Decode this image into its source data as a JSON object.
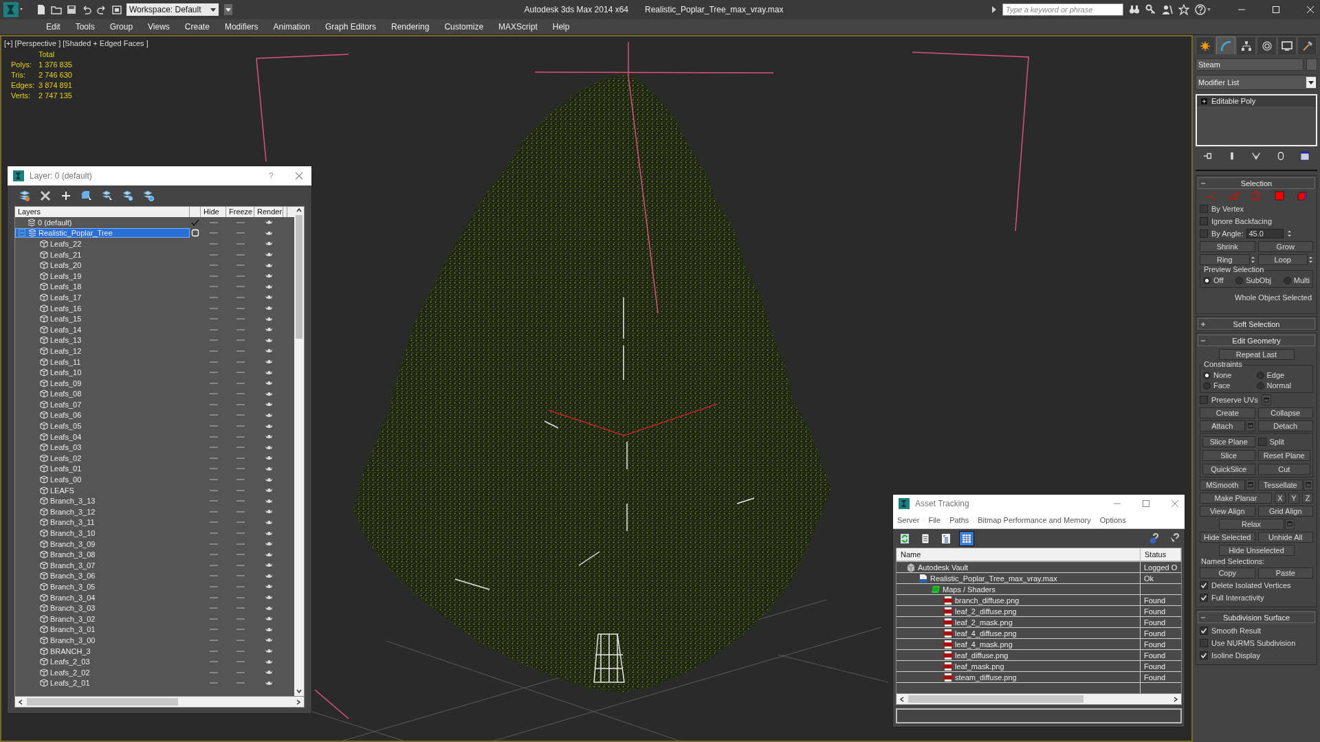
{
  "title_bar": {
    "workspace": "Workspace: Default",
    "app_title": "Autodesk 3ds Max 2014 x64",
    "file_name": "Realistic_Poplar_Tree_max_vray.max",
    "search": {
      "placeholder": "Type a keyword or phrase"
    }
  },
  "menu": [
    "Edit",
    "Tools",
    "Group",
    "Views",
    "Create",
    "Modifiers",
    "Animation",
    "Graph Editors",
    "Rendering",
    "Customize",
    "MAXScript",
    "Help"
  ],
  "viewport": {
    "label": "[+] [Perspective ] [Shaded + Edged Faces ]",
    "stats": {
      "header": "Total",
      "rows": [
        {
          "label": "Polys:",
          "value": "1 376 835"
        },
        {
          "label": "Tris:",
          "value": "2 746 630"
        },
        {
          "label": "Edges:",
          "value": "3 874 891"
        },
        {
          "label": "Verts:",
          "value": "2 747 135"
        }
      ]
    }
  },
  "layer_manager": {
    "title": "Layer: 0 (default)",
    "help": "?",
    "columns": [
      "Layers",
      "Hide",
      "Freeze",
      "Render"
    ],
    "layers": [
      {
        "name": "0 (default)",
        "current": true,
        "selected": false
      },
      {
        "name": "Realistic_Poplar_Tree",
        "current": false,
        "selected": true,
        "expanded": true,
        "children": [
          {
            "name": "Leafs_22",
            "selected": false
          },
          {
            "name": "Leafs_21",
            "selected": false
          },
          {
            "name": "Leafs_20",
            "selected": false
          },
          {
            "name": "Leafs_19",
            "selected": false
          },
          {
            "name": "Leafs_18",
            "selected": false
          },
          {
            "name": "Leafs_17",
            "selected": false
          },
          {
            "name": "Leafs_16",
            "selected": false
          },
          {
            "name": "Leafs_15",
            "selected": false
          },
          {
            "name": "Leafs_14",
            "selected": false
          },
          {
            "name": "Leafs_13",
            "selected": false
          },
          {
            "name": "Leafs_12",
            "selected": false
          },
          {
            "name": "Leafs_11",
            "selected": false
          },
          {
            "name": "Leafs_10",
            "selected": false
          },
          {
            "name": "Leafs_09",
            "selected": false
          },
          {
            "name": "Leafs_08",
            "selected": false
          },
          {
            "name": "Leafs_07",
            "selected": false
          },
          {
            "name": "Leafs_06",
            "selected": false
          },
          {
            "name": "Leafs_05",
            "selected": false
          },
          {
            "name": "Leafs_04",
            "selected": false
          },
          {
            "name": "Leafs_03",
            "selected": false
          },
          {
            "name": "Leafs_02",
            "selected": false
          },
          {
            "name": "Leafs_01",
            "selected": false
          },
          {
            "name": "Leafs_00",
            "selected": false
          },
          {
            "name": "LEAFS",
            "selected": false
          },
          {
            "name": "Branch_3_13",
            "selected": false
          },
          {
            "name": "Branch_3_12",
            "selected": false
          },
          {
            "name": "Branch_3_11",
            "selected": false
          },
          {
            "name": "Branch_3_10",
            "selected": false
          },
          {
            "name": "Branch_3_09",
            "selected": false
          },
          {
            "name": "Branch_3_08",
            "selected": false
          },
          {
            "name": "Branch_3_07",
            "selected": false
          },
          {
            "name": "Branch_3_06",
            "selected": false
          },
          {
            "name": "Branch_3_05",
            "selected": false
          },
          {
            "name": "Branch_3_04",
            "selected": false
          },
          {
            "name": "Branch_3_03",
            "selected": false
          },
          {
            "name": "Branch_3_02",
            "selected": false
          },
          {
            "name": "Branch_3_01",
            "selected": false
          },
          {
            "name": "Branch_3_00",
            "selected": false
          },
          {
            "name": "BRANCH_3",
            "selected": false
          },
          {
            "name": "Leafs_2_03",
            "selected": false
          },
          {
            "name": "Leafs_2_02",
            "selected": false
          },
          {
            "name": "Leafs_2_01",
            "selected": false
          }
        ]
      }
    ]
  },
  "asset_tracking": {
    "title": "Asset Tracking",
    "menu": [
      "Server",
      "File",
      "Paths",
      "Bitmap Performance and Memory",
      "Options"
    ],
    "toolbar": [
      {
        "selected": false
      },
      {
        "selected": false
      },
      {
        "selected": false
      },
      {
        "selected": true
      }
    ],
    "columns": [
      "Name",
      "Status"
    ],
    "rows": [
      {
        "name": "Autodesk Vault",
        "kind": "vault",
        "status": "Logged O",
        "children": [
          {
            "name": "Realistic_Poplar_Tree_max_vray.max",
            "kind": "max",
            "status": "Ok",
            "children": [
              {
                "name": "Maps / Shaders",
                "kind": "maps",
                "children": [
                  {
                    "name": "branch_diffuse.png",
                    "kind": "png",
                    "status": "Found"
                  },
                  {
                    "name": "leaf_2_diffuse.png",
                    "kind": "png",
                    "status": "Found"
                  },
                  {
                    "name": "leaf_2_mask.png",
                    "kind": "png",
                    "status": "Found"
                  },
                  {
                    "name": "leaf_4_diffuse.png",
                    "kind": "png",
                    "status": "Found"
                  },
                  {
                    "name": "leaf_4_mask.png",
                    "kind": "png",
                    "status": "Found"
                  },
                  {
                    "name": "leaf_diffuse.png",
                    "kind": "png",
                    "status": "Found"
                  },
                  {
                    "name": "leaf_mask.png",
                    "kind": "png",
                    "status": "Found"
                  },
                  {
                    "name": "steam_diffuse.png",
                    "kind": "png",
                    "status": "Found"
                  }
                ]
              }
            ]
          }
        ]
      }
    ]
  },
  "command_panel": {
    "tabs": [
      {
        "selected": false
      },
      {
        "selected": true
      },
      {
        "selected": false
      },
      {
        "selected": false
      },
      {
        "selected": false
      },
      {
        "selected": false
      }
    ],
    "object_name": "Steam",
    "modifier_list": "Modifier List",
    "stack": [
      "Editable Poly"
    ],
    "rollouts": [
      {
        "title": "Selection",
        "expanded": true,
        "rows": [
          {
            "kind": "subobjects"
          },
          {
            "kind": "checkbox",
            "label": "By Vertex",
            "checked": false
          },
          {
            "kind": "checkbox",
            "label": "Ignore Backfacing",
            "checked": false
          },
          {
            "kind": "angle",
            "label": "By Angle:",
            "value": "45.0",
            "checked": false
          },
          {
            "kind": "buttons",
            "items": [
              {
                "kind": "button",
                "label": "Shrink"
              },
              {
                "kind": "button",
                "label": "Grow"
              }
            ]
          },
          {
            "kind": "buttons",
            "items": [
              {
                "kind": "button",
                "label": "Ring",
                "spinner": true
              },
              {
                "kind": "button",
                "label": "Loop",
                "spinner": true
              }
            ]
          },
          {
            "kind": "radios",
            "title": "Preview Selection",
            "options": [
              {
                "label": "Off",
                "selected": true
              },
              {
                "label": "SubObj",
                "selected": false
              },
              {
                "label": "Multi",
                "selected": false
              }
            ]
          },
          {
            "kind": "note",
            "text": "Whole Object Selected"
          }
        ]
      },
      {
        "title": "Soft Selection",
        "expanded": false
      },
      {
        "title": "Edit Geometry",
        "expanded": true,
        "rows": [
          {
            "kind": "buttons",
            "items": [
              {
                "kind": "button",
                "label": "Repeat Last"
              }
            ]
          },
          {
            "kind": "radios",
            "title": "Constraints",
            "options": [
              {
                "label": "None",
                "selected": true
              },
              {
                "label": "Edge",
                "selected": false
              },
              {
                "label": "Face",
                "selected": false
              },
              {
                "label": "Normal",
                "selected": false
              }
            ]
          },
          {
            "kind": "checkbox",
            "label": "Preserve UVs",
            "checked": false,
            "settings": true
          },
          {
            "kind": "buttons",
            "items": [
              {
                "kind": "button",
                "label": "Create"
              },
              {
                "kind": "button",
                "label": "Collapse"
              }
            ]
          },
          {
            "kind": "buttons",
            "items": [
              {
                "kind": "button",
                "label": "Attach",
                "settings": true
              },
              {
                "kind": "button",
                "label": "Detach"
              }
            ]
          },
          {
            "kind": "group",
            "rows": [
              {
                "kind": "buttons",
                "items": [
                  {
                    "kind": "button",
                    "label": "Slice Plane"
                  },
                  {
                    "kind": "checkbox",
                    "label": "Split",
                    "checked": false
                  }
                ]
              },
              {
                "kind": "buttons",
                "items": [
                  {
                    "kind": "button",
                    "label": "Slice"
                  },
                  {
                    "kind": "button",
                    "label": "Reset Plane"
                  }
                ]
              },
              {
                "kind": "buttons",
                "items": [
                  {
                    "kind": "button",
                    "label": "QuickSlice"
                  },
                  {
                    "kind": "button",
                    "label": "Cut"
                  }
                ]
              }
            ]
          },
          {
            "kind": "buttons",
            "items": [
              {
                "kind": "button",
                "label": "MSmooth",
                "settings": true
              },
              {
                "kind": "button",
                "label": "Tessellate",
                "settings": true
              }
            ]
          },
          {
            "kind": "buttons",
            "items": [
              {
                "kind": "button",
                "label": "Make Planar"
              },
              {
                "kind": "button",
                "label": "X",
                "small": true
              },
              {
                "kind": "button",
                "label": "Y",
                "small": true
              },
              {
                "kind": "button",
                "label": "Z",
                "small": true
              }
            ]
          },
          {
            "kind": "buttons",
            "items": [
              {
                "kind": "button",
                "label": "View Align"
              },
              {
                "kind": "button",
                "label": "Grid Align"
              }
            ]
          },
          {
            "kind": "buttons",
            "items": [
              {
                "kind": "button",
                "label": "Relax",
                "settings": true
              }
            ]
          },
          {
            "kind": "buttons",
            "items": [
              {
                "kind": "button",
                "label": "Hide Selected"
              },
              {
                "kind": "button",
                "label": "Unhide All"
              }
            ]
          },
          {
            "kind": "buttons",
            "items": [
              {
                "kind": "button",
                "label": "Hide Unselected"
              }
            ]
          },
          {
            "kind": "label",
            "text": "Named Selections:"
          },
          {
            "kind": "buttons",
            "items": [
              {
                "kind": "button",
                "label": "Copy"
              },
              {
                "kind": "button",
                "label": "Paste"
              }
            ]
          },
          {
            "kind": "checkbox",
            "label": "Delete Isolated Vertices",
            "checked": true
          },
          {
            "kind": "checkbox",
            "label": "Full Interactivity",
            "checked": true
          }
        ]
      },
      {
        "title": "Subdivision Surface",
        "expanded": true,
        "rows": [
          {
            "kind": "checkbox",
            "label": "Smooth Result",
            "checked": true
          },
          {
            "kind": "checkbox",
            "label": "Use NURMS Subdivision",
            "checked": false
          },
          {
            "kind": "checkbox",
            "label": "Isoline Display",
            "checked": true
          }
        ]
      }
    ]
  }
}
